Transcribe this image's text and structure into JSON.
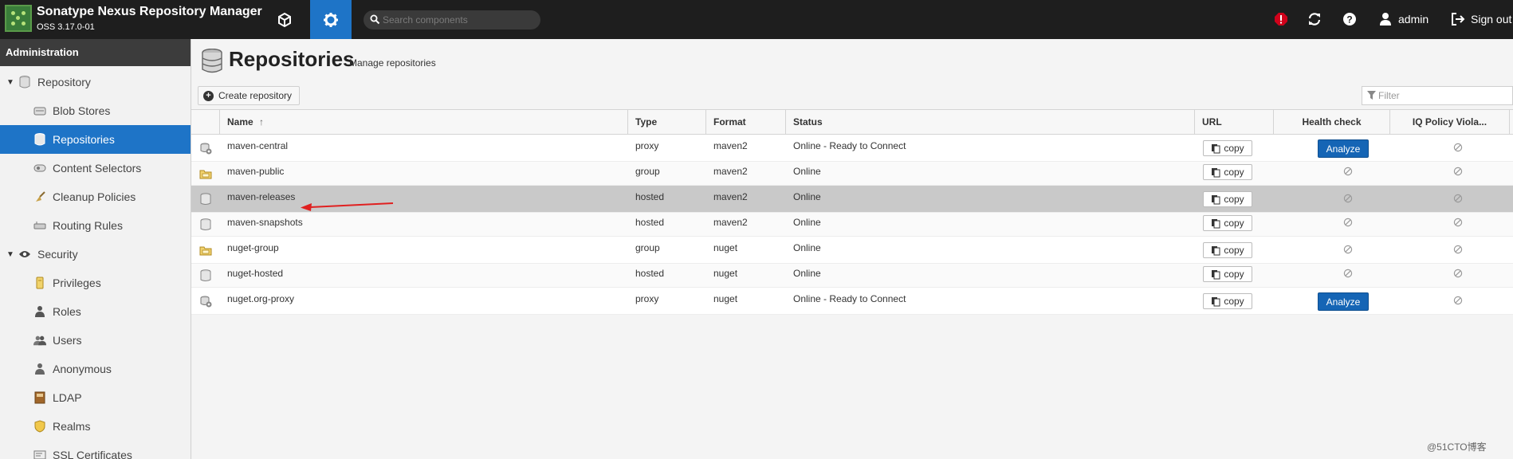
{
  "header": {
    "app_title": "Sonatype Nexus Repository Manager",
    "app_version": "OSS 3.17.0-01",
    "browse_icon": "cube-icon",
    "admin_icon": "gear-icon",
    "search_placeholder": "Search components",
    "alert_icon": "alert-icon",
    "refresh_icon": "refresh-icon",
    "help_icon": "help-icon",
    "user_label": "admin",
    "signout_label": "Sign out"
  },
  "sidebar": {
    "title": "Administration",
    "items": [
      {
        "label": "Repository",
        "icon": "database-icon",
        "group": true
      },
      {
        "label": "Blob Stores",
        "icon": "blob-store-icon"
      },
      {
        "label": "Repositories",
        "icon": "database-icon",
        "selected": true
      },
      {
        "label": "Content Selectors",
        "icon": "content-selector-icon"
      },
      {
        "label": "Cleanup Policies",
        "icon": "broom-icon"
      },
      {
        "label": "Routing Rules",
        "icon": "routing-icon"
      },
      {
        "label": "Security",
        "icon": "eye-icon",
        "group": true
      },
      {
        "label": "Privileges",
        "icon": "privilege-icon"
      },
      {
        "label": "Roles",
        "icon": "role-icon"
      },
      {
        "label": "Users",
        "icon": "users-icon"
      },
      {
        "label": "Anonymous",
        "icon": "anonymous-icon"
      },
      {
        "label": "LDAP",
        "icon": "ldap-book-icon"
      },
      {
        "label": "Realms",
        "icon": "shield-icon"
      },
      {
        "label": "SSL Certificates",
        "icon": "certificate-icon"
      }
    ]
  },
  "main": {
    "title": "Repositories",
    "subtitle": "Manage repositories",
    "create_label": "Create repository",
    "filter_placeholder": "Filter",
    "columns": {
      "name": "Name",
      "type": "Type",
      "format": "Format",
      "status": "Status",
      "url": "URL",
      "health": "Health check",
      "iq": "IQ Policy Viola..."
    },
    "copy_label": "copy",
    "analyze_label": "Analyze",
    "rows": [
      {
        "name": "maven-central",
        "type": "proxy",
        "format": "maven2",
        "status": "Online - Ready to Connect",
        "icon": "proxy-icon",
        "analyze": true
      },
      {
        "name": "maven-public",
        "type": "group",
        "format": "maven2",
        "status": "Online",
        "icon": "group-folder-icon",
        "analyze": false
      },
      {
        "name": "maven-releases",
        "type": "hosted",
        "format": "maven2",
        "status": "Online",
        "icon": "hosted-icon",
        "analyze": false,
        "selected": true
      },
      {
        "name": "maven-snapshots",
        "type": "hosted",
        "format": "maven2",
        "status": "Online",
        "icon": "hosted-icon",
        "analyze": false
      },
      {
        "name": "nuget-group",
        "type": "group",
        "format": "nuget",
        "status": "Online",
        "icon": "group-folder-icon",
        "analyze": false
      },
      {
        "name": "nuget-hosted",
        "type": "hosted",
        "format": "nuget",
        "status": "Online",
        "icon": "hosted-icon",
        "analyze": false
      },
      {
        "name": "nuget.org-proxy",
        "type": "proxy",
        "format": "nuget",
        "status": "Online - Ready to Connect",
        "icon": "proxy-icon",
        "analyze": true
      }
    ]
  },
  "watermark": "@51CTO博客",
  "colors": {
    "header_bg": "#1e1e1e",
    "accent": "#1e74c7",
    "analyze": "#1565b5",
    "alert": "#d0021b",
    "arrow": "#e02020"
  }
}
